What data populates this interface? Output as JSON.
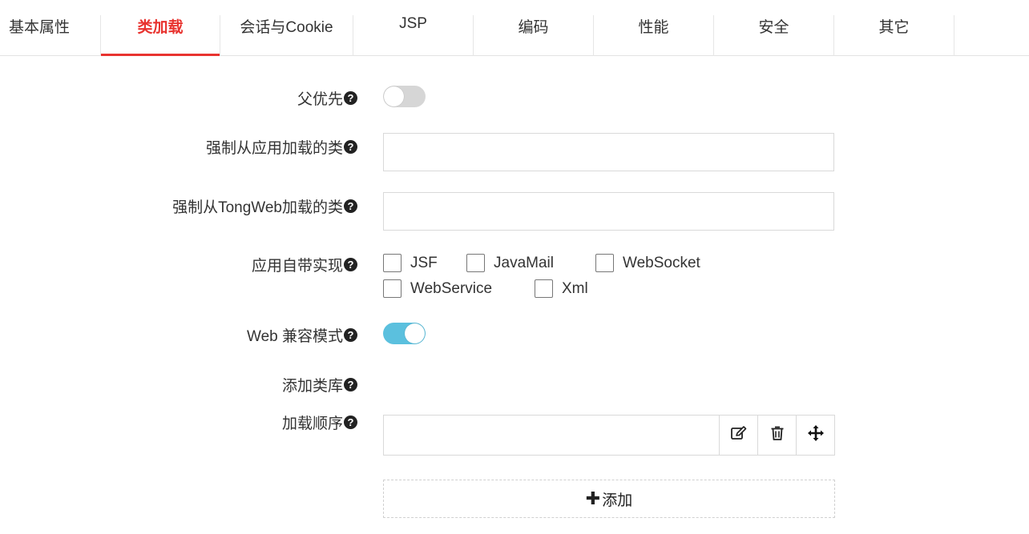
{
  "tabs": [
    {
      "label": "基本属性",
      "active": false
    },
    {
      "label": "类加载",
      "active": true
    },
    {
      "label": "会话与Cookie",
      "active": false
    },
    {
      "label": "JSP",
      "active": false
    },
    {
      "label": "编码",
      "active": false
    },
    {
      "label": "性能",
      "active": false
    },
    {
      "label": "安全",
      "active": false
    },
    {
      "label": "其它",
      "active": false
    }
  ],
  "colors": {
    "accent": "#e8332f",
    "toggle_on": "#5bc0de",
    "toggle_off": "#d6d6d6"
  },
  "form": {
    "parent_first": {
      "label": "父优先",
      "enabled": false
    },
    "force_app_classes": {
      "label": "强制从应用加载的类",
      "value": ""
    },
    "force_tongweb_classes": {
      "label": "强制从TongWeb加载的类",
      "value": ""
    },
    "app_bundled": {
      "label": "应用自带实现",
      "options": [
        {
          "label": "JSF",
          "checked": false
        },
        {
          "label": "JavaMail",
          "checked": false
        },
        {
          "label": "WebSocket",
          "checked": false
        },
        {
          "label": "WebService",
          "checked": false
        },
        {
          "label": "Xml",
          "checked": false
        }
      ]
    },
    "web_compat": {
      "label": "Web 兼容模式",
      "enabled": true
    },
    "add_library": {
      "label": "添加类库"
    },
    "load_order": {
      "label": "加载顺序",
      "value": ""
    },
    "add_button": {
      "icon": "plus-icon",
      "label": "添加"
    }
  },
  "icons": {
    "help": "question-circle-icon",
    "edit": "edit-icon",
    "delete": "trash-icon",
    "move": "move-icon"
  }
}
